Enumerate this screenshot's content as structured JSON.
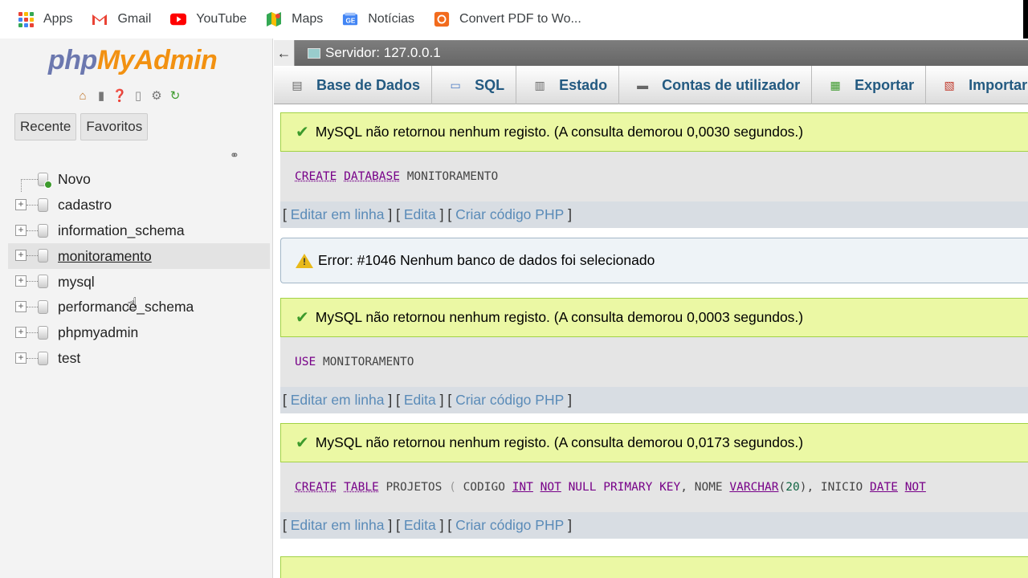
{
  "bookmarks": [
    {
      "label": "Apps",
      "icon": "apps-grid-icon"
    },
    {
      "label": "Gmail",
      "icon": "gmail-icon"
    },
    {
      "label": "YouTube",
      "icon": "youtube-icon"
    },
    {
      "label": "Maps",
      "icon": "maps-icon"
    },
    {
      "label": "Notícias",
      "icon": "news-icon"
    },
    {
      "label": "Convert PDF to Wo...",
      "icon": "convert-pdf-icon"
    }
  ],
  "sidebar": {
    "logo": {
      "php": "php",
      "my": "My",
      "admin": "Admin"
    },
    "recent_label": "Recente",
    "favorites_label": "Favoritos",
    "tree": [
      {
        "label": "Novo"
      },
      {
        "label": "cadastro"
      },
      {
        "label": "information_schema"
      },
      {
        "label": "monitoramento"
      },
      {
        "label": "mysql"
      },
      {
        "label": "performance_schema"
      },
      {
        "label": "phpmyadmin"
      },
      {
        "label": "test"
      }
    ]
  },
  "header": {
    "back": "←",
    "server": "Servidor: 127.0.0.1"
  },
  "tabs": [
    {
      "label": "Base de Dados"
    },
    {
      "label": "SQL"
    },
    {
      "label": "Estado"
    },
    {
      "label": "Contas de utilizador"
    },
    {
      "label": "Exportar"
    },
    {
      "label": "Importar"
    }
  ],
  "messages": {
    "success1": "MySQL não retornou nenhum registo. (A consulta demorou 0,0030 segundos.)",
    "query1": {
      "kw1": "CREATE",
      "kw2": "DATABASE",
      "name": "MONITORAMENTO"
    },
    "error": "Error: #1046 Nenhum banco de dados foi selecionado",
    "success2": "MySQL não retornou nenhum registo. (A consulta demorou 0,0003 segundos.)",
    "query2": {
      "kw1": "USE",
      "name": "MONITORAMENTO"
    },
    "success3": "MySQL não retornou nenhum registo. (A consulta demorou 0,0173 segundos.)",
    "query3": {
      "create": "CREATE",
      "table": "TABLE",
      "name": "PROJETOS",
      "open": "(",
      "col1": "CODIGO",
      "int": "INT",
      "not1": "NOT",
      "null1": "NULL",
      "primary": "PRIMARY",
      "key": "KEY",
      "comma1": ",",
      "col2": "NOME",
      "varchar": "VARCHAR",
      "size_open": "(",
      "size": "20",
      "size_close": ")",
      "comma2": ",",
      "col3": "INICIO",
      "date": "DATE",
      "not2": "NOT"
    },
    "links": {
      "open": "[",
      "edit_inline": "Editar em linha",
      "sep1": "] [",
      "edit": "Edita",
      "sep2": "] [",
      "php": "Criar código PHP",
      "close": "]"
    }
  },
  "colors": {
    "success_bg": "#ebf8a4",
    "keyword": "#770088",
    "link": "#5a8bb8"
  }
}
